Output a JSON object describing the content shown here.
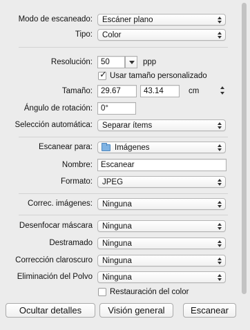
{
  "fields": {
    "scan_mode": {
      "label": "Modo de escaneado:",
      "value": "Escáner plano"
    },
    "type": {
      "label": "Tipo:",
      "value": "Color"
    },
    "resolution": {
      "label": "Resolución:",
      "value": "50",
      "unit": "ppp"
    },
    "custom_size": {
      "label": "Usar tamaño personalizado",
      "checked": true
    },
    "size": {
      "label": "Tamaño:",
      "width": "29.67",
      "height": "43.14",
      "unit": "cm"
    },
    "rotation": {
      "label": "Ángulo de rotación:",
      "value": "0°"
    },
    "auto_selection": {
      "label": "Selección automática:",
      "value": "Separar ítems"
    },
    "scan_to": {
      "label": "Escanear para:",
      "value": "Imágenes"
    },
    "name": {
      "label": "Nombre:",
      "value": "Escanear"
    },
    "format": {
      "label": "Formato:",
      "value": "JPEG"
    },
    "image_correction": {
      "label": "Correc. imágenes:",
      "value": "Ninguna"
    },
    "unsharp_mask": {
      "label": "Desenfocar máscara",
      "value": "Ninguna"
    },
    "descreen": {
      "label": "Destramado",
      "value": "Ninguna"
    },
    "backlight": {
      "label": "Corrección claroscuro",
      "value": "Ninguna"
    },
    "dust_removal": {
      "label": "Eliminación del Polvo",
      "value": "Ninguna"
    },
    "color_restoration": {
      "label": "Restauración del color",
      "checked": false
    }
  },
  "buttons": {
    "hide_details": "Ocultar detalles",
    "overview": "Visión general",
    "scan": "Escanear"
  },
  "icons": {
    "folder": "folder-icon",
    "check": "checkmark-icon"
  }
}
